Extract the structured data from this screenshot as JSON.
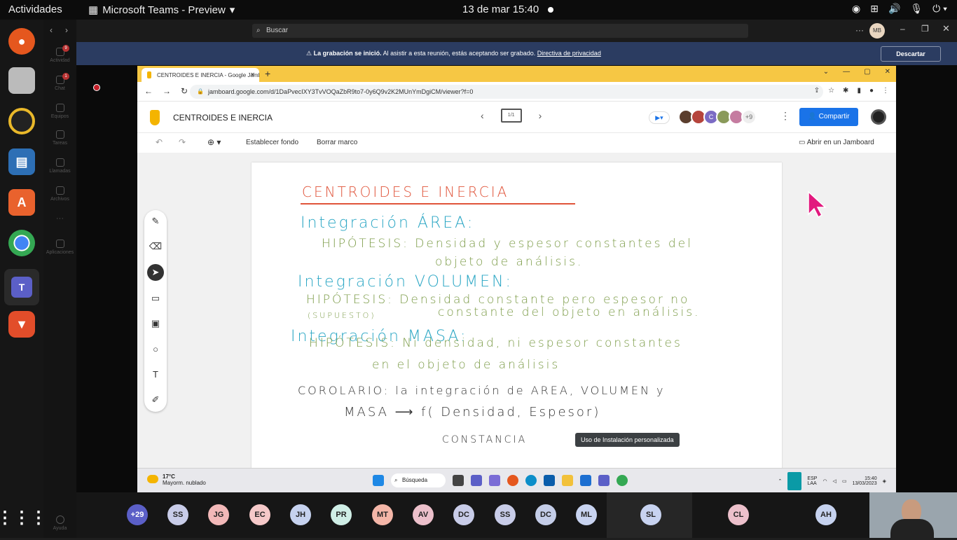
{
  "topbar": {
    "activities": "Actividades",
    "app_title": "Microsoft Teams - Preview",
    "clock": "13 de mar  15:40"
  },
  "teams": {
    "search_placeholder": "Buscar",
    "rail": [
      {
        "label": "Actividad",
        "badge": "9"
      },
      {
        "label": "Chat",
        "badge": "1"
      },
      {
        "label": "Equipos"
      },
      {
        "label": "Tareas"
      },
      {
        "label": "Llamadas"
      },
      {
        "label": "Archivos"
      },
      {
        "label": "···"
      },
      {
        "label": "Aplicaciones"
      },
      {
        "label": "Ayuda"
      }
    ],
    "user_initials": "MB"
  },
  "recording": {
    "bold": "La grabación se inició.",
    "text": "Al asistir a esta reunión, estás aceptando ser grabado.",
    "link": "Directiva de privacidad",
    "dismiss": "Descartar"
  },
  "browser": {
    "tab_title": "CENTROIDES E INERCIA - Google Jamboard",
    "url": "jamboard.google.com/d/1DaPvecIXY3TvVOQaZbR9to7-0y6Q9v2K2MUnYmDgiCM/viewer?f=0"
  },
  "jamboard": {
    "title": "CENTROIDES E INERCIA",
    "frame": "1/1",
    "extra_count": "+9",
    "share": "Compartir",
    "set_bg": "Establecer fondo",
    "clear_frame": "Borrar marco",
    "open_in": "Abrir en un Jamboard",
    "avatar_colors": [
      "#5b3e2e",
      "#b5443c",
      "#7b6bc4",
      "#8a9a5a",
      "#c57ca0"
    ],
    "avatar_c": "C"
  },
  "board_lines": [
    {
      "text": "CENTROIDES E INERCIA",
      "color": "#e0543a"
    },
    {
      "text": "Integración ÁREA:",
      "color": "#2aa6c4"
    },
    {
      "text": "HIPÓTESIS: Densidad y espesor constantes del",
      "color": "#7a9a45"
    },
    {
      "text": "objeto de análisis.",
      "color": "#7a9a45"
    },
    {
      "text": "Integración VOLUMEN:",
      "color": "#2aa6c4"
    },
    {
      "text": "HIPÓTESIS: Densidad constante pero espesor no",
      "color": "#7a9a45"
    },
    {
      "text": "(SUPUESTO)",
      "color": "#7a9a45"
    },
    {
      "text": "constante del objeto en análisis.",
      "color": "#7a9a45"
    },
    {
      "text": "Integración MASA:",
      "color": "#2aa6c4"
    },
    {
      "text": "HIPÓTESIS: Ni densidad, ni espesor constantes",
      "color": "#7a9a45"
    },
    {
      "text": "en el objeto de análisis",
      "color": "#7a9a45"
    },
    {
      "text": "COROLARIO: la integración de AREA, VOLUMEN y",
      "color": "#333333"
    },
    {
      "text": "MASA ⟶ f( Densidad, Espesor)",
      "color": "#333333"
    },
    {
      "text": "CONSTANCIA",
      "color": "#333333"
    }
  ],
  "tooltip": "Uso de Instalación personalizada",
  "taskbar": {
    "temp": "17°C",
    "weather": "Mayorm. nublado",
    "search": "Búsqueda",
    "lang1": "ESP",
    "lang2": "LAA",
    "time": "15:40",
    "date": "13/03/2023"
  },
  "participants": [
    "+29",
    "SS",
    "JG",
    "EC",
    "JH",
    "PR",
    "MT",
    "AV",
    "DC",
    "SS",
    "DC",
    "ML",
    "SL",
    "CL",
    "AH"
  ],
  "participant_colors": [
    "#5b5fc7",
    "#c8cce8",
    "#f2b8b8",
    "#f5c9c9",
    "#c6d2ef",
    "#cfeee6",
    "#f4b6a8",
    "#ecc0cb",
    "#c8cce8",
    "#c8cce8",
    "#c4cde8",
    "#c8d3f0",
    "#c8d3f0",
    "#ecc0cb",
    "#c6d2ef"
  ]
}
